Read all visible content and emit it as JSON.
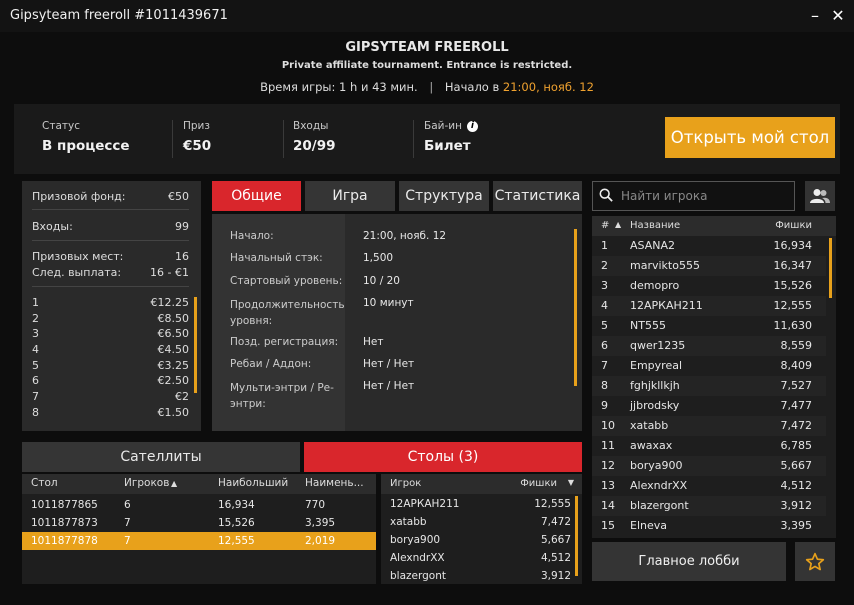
{
  "window": {
    "title": "Gipsyteam freeroll #1011439671"
  },
  "header": {
    "name": "GIPSYTEAM FREEROLL",
    "subtitle": "Private affiliate tournament. Entrance is restricted.",
    "time_label": "Время игры:",
    "time_value": "1 h и 43 мин.",
    "start_label": "Начало в",
    "start_value": "21:00, нояб. 12"
  },
  "info": {
    "status_label": "Статус",
    "status_value": "В процессе",
    "prize_label": "Приз",
    "prize_value": "€50",
    "entries_label": "Входы",
    "entries_value": "20/99",
    "buyin_label": "Бай-ин",
    "buyin_value": "Билет",
    "open_table": "Открыть мой стол"
  },
  "prize_panel": {
    "pool_label": "Призовой фонд:",
    "pool_value": "€50",
    "entries_label": "Входы:",
    "entries_value": "99",
    "places_label": "Призовых мест:",
    "places_value": "16",
    "next_label": "След. выплата:",
    "next_value": "16 - €1",
    "payouts": [
      {
        "place": "1",
        "amount": "€12.25"
      },
      {
        "place": "2",
        "amount": "€8.50"
      },
      {
        "place": "3",
        "amount": "€6.50"
      },
      {
        "place": "4",
        "amount": "€4.50"
      },
      {
        "place": "5",
        "amount": "€3.25"
      },
      {
        "place": "6",
        "amount": "€2.50"
      },
      {
        "place": "7",
        "amount": "€2"
      },
      {
        "place": "8",
        "amount": "€1.50"
      }
    ]
  },
  "tabs": [
    "Общие",
    "Игра",
    "Структура",
    "Статистика"
  ],
  "general": [
    {
      "label": "Начало:",
      "value": "21:00, нояб. 12"
    },
    {
      "label": "Начальный стэк:",
      "value": "1,500"
    },
    {
      "label": "Стартовый уровень:",
      "value": "10 / 20"
    },
    {
      "label": "Продолжительность уровня:",
      "value": "10 минут"
    },
    {
      "label": "Позд. регистрация:",
      "value": "Нет"
    },
    {
      "label": "Ребаи / Аддон:",
      "value": "Нет / Нет"
    },
    {
      "label": "Мульти-энтри / Ре-энтри:",
      "value": "Нет / Нет"
    }
  ],
  "search": {
    "placeholder": "Найти игрока"
  },
  "players": {
    "headers": {
      "rank": "#",
      "name": "Название",
      "chips": "Фишки"
    },
    "rows": [
      {
        "rank": "1",
        "name": "ASANA2",
        "chips": "16,934"
      },
      {
        "rank": "2",
        "name": "marvikto555",
        "chips": "16,347"
      },
      {
        "rank": "3",
        "name": "demopro",
        "chips": "15,526"
      },
      {
        "rank": "4",
        "name": "12АРКАН211",
        "chips": "12,555"
      },
      {
        "rank": "5",
        "name": "NT555",
        "chips": "11,630"
      },
      {
        "rank": "6",
        "name": "qwer1235",
        "chips": "8,559"
      },
      {
        "rank": "7",
        "name": "Empyreal",
        "chips": "8,409"
      },
      {
        "rank": "8",
        "name": "fghjkllkjh",
        "chips": "7,527"
      },
      {
        "rank": "9",
        "name": "jjbrodsky",
        "chips": "7,477"
      },
      {
        "rank": "10",
        "name": "xatabb",
        "chips": "7,472"
      },
      {
        "rank": "11",
        "name": "awaxax",
        "chips": "6,785"
      },
      {
        "rank": "12",
        "name": "borya900",
        "chips": "5,667"
      },
      {
        "rank": "13",
        "name": "AlexndrXX",
        "chips": "4,512"
      },
      {
        "rank": "14",
        "name": "blazergont",
        "chips": "3,912"
      },
      {
        "rank": "15",
        "name": "Elneva",
        "chips": "3,395"
      }
    ]
  },
  "lobby_button": "Главное лобби",
  "bottom_tabs": {
    "satellites": "Сателлиты",
    "tables": "Столы (3)"
  },
  "tables": {
    "headers": {
      "table": "Стол",
      "players": "Игроков",
      "largest": "Наибольший",
      "smallest": "Наимень..."
    },
    "rows": [
      {
        "table": "1011877865",
        "players": "6",
        "largest": "16,934",
        "smallest": "770"
      },
      {
        "table": "1011877873",
        "players": "7",
        "largest": "15,526",
        "smallest": "3,395"
      },
      {
        "table": "1011877878",
        "players": "7",
        "largest": "12,555",
        "smallest": "2,019"
      }
    ]
  },
  "table_players": {
    "headers": {
      "player": "Игрок",
      "chips": "Фишки"
    },
    "rows": [
      {
        "name": "12АРКАН211",
        "chips": "12,555"
      },
      {
        "name": "xatabb",
        "chips": "7,472"
      },
      {
        "name": "borya900",
        "chips": "5,667"
      },
      {
        "name": "AlexndrXX",
        "chips": "4,512"
      },
      {
        "name": "blazergont",
        "chips": "3,912"
      }
    ]
  }
}
